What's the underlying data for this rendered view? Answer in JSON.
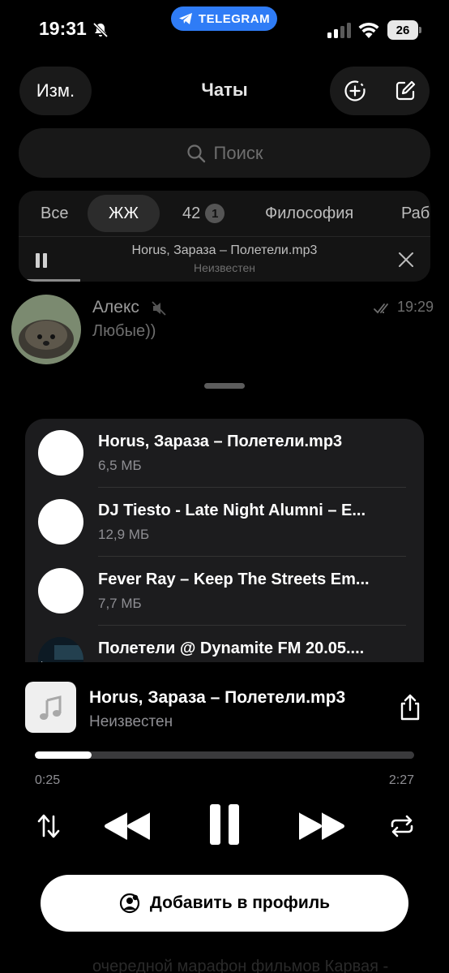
{
  "status_bar": {
    "time": "19:31",
    "battery": "26",
    "app_pill": "TELEGRAM"
  },
  "header": {
    "edit_label": "Изм.",
    "title": "Чаты"
  },
  "search": {
    "placeholder": "Поиск"
  },
  "filters": {
    "tabs": [
      {
        "label": "Все"
      },
      {
        "label": "ЖЖ",
        "active": true
      },
      {
        "label": "42",
        "badge": "1"
      },
      {
        "label": "Философия"
      },
      {
        "label": "Раб"
      }
    ]
  },
  "mini_player": {
    "title": "Horus, Зараза – Полетели.mp3",
    "subtitle": "Неизвестен"
  },
  "chat": {
    "name": "Алекс",
    "time": "19:29",
    "preview": "Любые))"
  },
  "playlist": {
    "tracks": [
      {
        "title": "Horus, Зараза – Полетели.mp3",
        "size": "6,5 МБ"
      },
      {
        "title": "DJ Tiesto - Late Night Alumni – E...",
        "size": "12,9 МБ"
      },
      {
        "title": "Fever Ray – Keep The Streets Em...",
        "size": "7,7 МБ"
      },
      {
        "title": "Полетели @ Dynamite FM 20.05....",
        "size": ""
      }
    ]
  },
  "now_playing": {
    "title": "Horus, Зараза – Полетели.mp3",
    "artist": "Неизвестен",
    "elapsed": "0:25",
    "total": "2:27",
    "progress_fraction": 0.15
  },
  "actions": {
    "add_to_profile": "Добавить в профиль"
  },
  "background_text": "очередной марафон фильмов Карвая -"
}
